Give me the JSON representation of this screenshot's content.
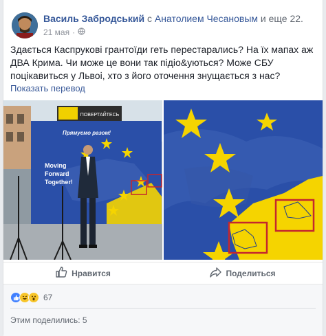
{
  "post": {
    "author": "Василь Забродський",
    "with_prefix": "с",
    "tagged": "Анатолием Чесановым",
    "and_more": "и еще 22.",
    "date": "21 мая",
    "dot": "·",
    "text": "Здається Каспрукові грантоїди геть перестарались? На їх мапах аж ДВА Крима. Чи може це вони так підіо&уються? Може СБУ поцікавиться у Львоі, хто з його оточення знущається з нас?",
    "translate_link": "Показать перевод"
  },
  "photo1": {
    "banner_line1": "Прямуємо разом!",
    "banner_line2": "Moving",
    "banner_line3": "Forward",
    "banner_line4": "Together!",
    "sign_text": "ПОВЕРТАЙТЕСЬ"
  },
  "actions": {
    "like": "Нравится",
    "share": "Поделиться"
  },
  "reactions": {
    "count": "67",
    "shares": "Этим поделились: 5"
  },
  "colors": {
    "link": "#365899",
    "eu_blue": "#2a4fa8",
    "eu_yellow": "#f5d400",
    "highlight_red": "#c4262e"
  },
  "icons": {
    "globe": "globe-icon",
    "like": "thumbs-up-icon",
    "share": "share-arrow-icon"
  }
}
